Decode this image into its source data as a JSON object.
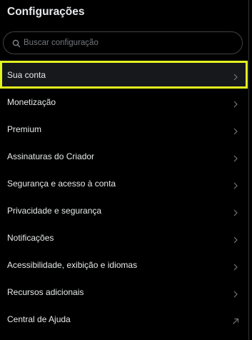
{
  "header": {
    "title": "Configurações"
  },
  "search": {
    "placeholder": "Buscar configuração",
    "value": ""
  },
  "menu": {
    "items": [
      {
        "label": "Sua conta",
        "icon": "chevron-right-icon",
        "selected": true
      },
      {
        "label": "Monetização",
        "icon": "chevron-right-icon"
      },
      {
        "label": "Premium",
        "icon": "chevron-right-icon"
      },
      {
        "label": "Assinaturas do Criador",
        "icon": "chevron-right-icon"
      },
      {
        "label": "Segurança e acesso à conta",
        "icon": "chevron-right-icon"
      },
      {
        "label": "Privacidade e segurança",
        "icon": "chevron-right-icon"
      },
      {
        "label": "Notificações",
        "icon": "chevron-right-icon"
      },
      {
        "label": "Acessibilidade, exibição e idiomas",
        "icon": "chevron-right-icon"
      },
      {
        "label": "Recursos adicionais",
        "icon": "chevron-right-icon"
      },
      {
        "label": "Central de Ajuda",
        "icon": "external-link-arrow-icon"
      }
    ]
  },
  "colors": {
    "background": "#000000",
    "text": "#e7e9ea",
    "muted": "#71767b",
    "highlight": "#e3f51f",
    "border": "#2f3336"
  }
}
